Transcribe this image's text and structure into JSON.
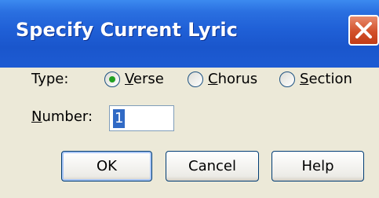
{
  "window": {
    "title": "Specify Current Lyric"
  },
  "type_row": {
    "label": "Type:",
    "options": [
      {
        "first": "V",
        "rest": "erse",
        "selected": true
      },
      {
        "first": "C",
        "rest": "horus",
        "selected": false
      },
      {
        "first": "S",
        "rest": "ection",
        "selected": false
      }
    ]
  },
  "number_row": {
    "label_first": "N",
    "label_rest": "umber:",
    "value": "1"
  },
  "buttons": {
    "ok": "OK",
    "cancel": "Cancel",
    "help": "Help"
  },
  "colors": {
    "titlebar": "#1f5fd6",
    "dialog_bg": "#ece9d8",
    "close_button": "#d2502a",
    "radio_selected": "#21a121",
    "selection": "#316ac5"
  }
}
